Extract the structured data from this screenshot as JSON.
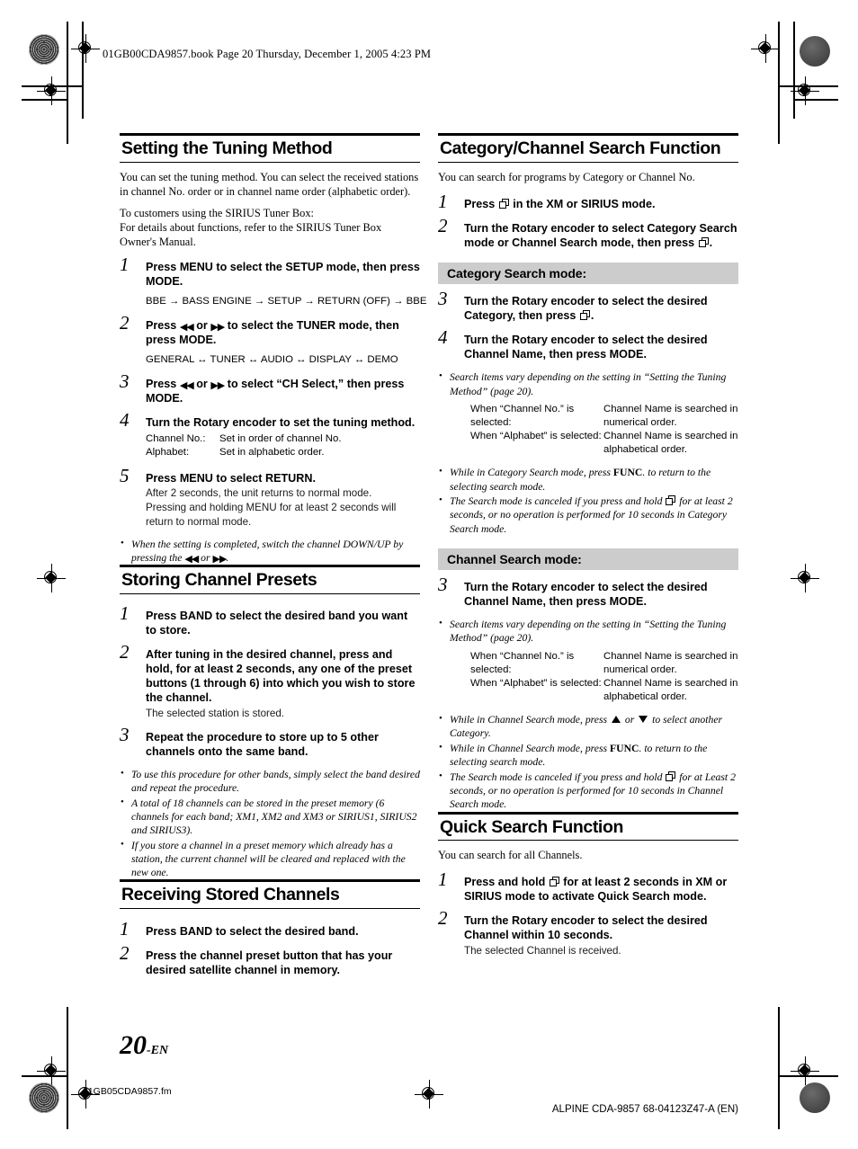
{
  "page": {
    "header_note": "01GB00CDA9857.book  Page 20  Thursday, December 1, 2005  4:23 PM",
    "page_number": "20",
    "page_number_suffix": "-EN",
    "footer_left": "01GB05CDA9857.fm",
    "footer_right": "ALPINE CDA-9857 68-04123Z47-A (EN)"
  },
  "left": {
    "s1": {
      "title": "Setting the Tuning Method",
      "intro1": "You can set the tuning method. You can select the received stations in channel No. order or in channel name order (alphabetic order).",
      "intro2_line1": "To customers using the SIRIUS Tuner Box:",
      "intro2_line2": "For details about functions, refer to the SIRIUS Tuner Box Owner's Manual.",
      "step1_num": "1",
      "step1_a": "Press ",
      "step1_b": "MENU",
      "step1_c": " to select the SETUP mode, then press ",
      "step1_d": "MODE",
      "step1_e": ".",
      "flow1": "BBE → BASS ENGINE → SETUP → RETURN (OFF) → BBE",
      "step2_num": "2",
      "step2_a": "Press ",
      "step2_b": " or ",
      "step2_c": " to select the TUNER mode, then press ",
      "step2_d": "MODE",
      "step2_e": ".",
      "flow2": "GENERAL ↔ TUNER ↔ AUDIO ↔ DISPLAY ↔ DEMO",
      "step3_num": "3",
      "step3_a": "Press ",
      "step3_b": " or ",
      "step3_c": " to select “CH Select,” then press ",
      "step3_d": "MODE",
      "step3_e": ".",
      "step4_num": "4",
      "step4_a": "Turn the ",
      "step4_b": "Rotary encoder",
      "step4_c": " to set the tuning method.",
      "kv": [
        {
          "k": "Channel No.:",
          "v": "Set in order of channel No."
        },
        {
          "k": "Alphabet:",
          "v": "Set in alphabetic order."
        }
      ],
      "step5_num": "5",
      "step5_a": "Press ",
      "step5_b": "MENU",
      "step5_c": " to select RETURN.",
      "step5_sub1": "After 2 seconds, the unit returns to normal mode.",
      "step5_sub2": "Pressing and holding MENU for at least 2 seconds will return to normal mode.",
      "note1_a": "When the setting is completed, switch the channel DOWN/UP by pressing the ",
      "note1_b": " or ",
      "note1_c": "."
    },
    "s2": {
      "title": "Storing Channel Presets",
      "step1_num": "1",
      "step1_a": "Press ",
      "step1_b": "BAND",
      "step1_c": " to select the desired band you want to store.",
      "step2_num": "2",
      "step2_a": "After tuning in the desired channel, press and hold, for at least 2 seconds, any one of the ",
      "step2_b": "preset buttons (1 through 6)",
      "step2_c": " into which you wish to store the channel.",
      "step2_sub": "The selected station is stored.",
      "step3_num": "3",
      "step3_a": "Repeat the procedure to store up to 5 other channels onto the same band.",
      "notes": [
        "To use this procedure for other bands, simply select the band desired and repeat the procedure.",
        "A total of 18 channels can be stored in the preset memory (6 channels for each band; XM1, XM2 and XM3 or SIRIUS1, SIRIUS2 and SIRIUS3).",
        "If you store a channel in a preset memory which already has a station, the current channel will be cleared and replaced with the new one."
      ]
    },
    "s3": {
      "title": "Receiving Stored Channels",
      "step1_num": "1",
      "step1_a": "Press ",
      "step1_b": "BAND",
      "step1_c": " to select the desired band.",
      "step2_num": "2",
      "step2_a": "Press the channel ",
      "step2_b": "preset button",
      "step2_c": " that has your desired satellite channel in memory."
    }
  },
  "right": {
    "s1": {
      "title": "Category/Channel Search Function",
      "intro": "You can search for programs by Category or Channel No.",
      "step1_num": "1",
      "step1_a": "Press ",
      "step1_b": " in the XM or SIRIUS mode.",
      "step2_num": "2",
      "step2_a": "Turn the ",
      "step2_b": "Rotary encoder",
      "step2_c": " to select Category Search mode or Channel Search mode, then press ",
      "step2_d": ".",
      "cat_bar": "Category Search mode:",
      "cat_step3_num": "3",
      "cat_step3_a": "Turn the ",
      "cat_step3_b": "Rotary encoder",
      "cat_step3_c": " to select the desired Category, then press ",
      "cat_step3_d": ".",
      "cat_step4_num": "4",
      "cat_step4_a": "Turn the ",
      "cat_step4_b": "Rotary encoder",
      "cat_step4_c": " to select the desired Channel Name, then press ",
      "cat_step4_d": "MODE",
      "cat_step4_e": ".",
      "cat_note1": "Search items vary depending on the setting in “Setting the Tuning Method” (page 20).",
      "cat_kv": [
        {
          "k": "When “Channel No.” is selected:",
          "v": "Channel Name is searched in numerical order."
        },
        {
          "k": "When “Alphabet” is selected:",
          "v": "Channel Name is searched in alphabetical order."
        }
      ],
      "cat_note2_a": "While in Category Search mode, press ",
      "cat_note2_b": "FUNC",
      "cat_note2_c": ". to return to the selecting search mode.",
      "cat_note3_a": "The Search mode is canceled if you press and hold ",
      "cat_note3_b": " for at least 2 seconds, or no operation is performed for 10 seconds in Category Search mode.",
      "chan_bar": "Channel Search mode:",
      "chan_step3_num": "3",
      "chan_step3_a": "Turn the ",
      "chan_step3_b": "Rotary encoder",
      "chan_step3_c": " to select the desired Channel Name, then press ",
      "chan_step3_d": "MODE",
      "chan_step3_e": ".",
      "chan_note1": "Search items vary depending on the setting in “Setting the Tuning Method” (page 20).",
      "chan_kv": [
        {
          "k": "When “Channel No.” is selected:",
          "v": "Channel Name is searched in numerical order."
        },
        {
          "k": "When “Alphabet” is selected:",
          "v": "Channel Name is searched in alphabetical order."
        }
      ],
      "chan_note2_a": "While in Channel Search mode, press ",
      "chan_note2_b": " or ",
      "chan_note2_c": " to select another Category.",
      "chan_note3_a": "While in Channel Search mode, press ",
      "chan_note3_b": "FUNC",
      "chan_note3_c": ". to return to the selecting search mode.",
      "chan_note4_a": "The Search mode is canceled if you press and hold ",
      "chan_note4_b": " for at Least 2 seconds, or no operation is performed for 10 seconds in Channel Search mode."
    },
    "s2": {
      "title": "Quick Search Function",
      "intro": "You can search for all Channels.",
      "step1_num": "1",
      "step1_a": "Press and hold ",
      "step1_b": " for at least 2 seconds in XM or SIRIUS mode to activate Quick Search mode.",
      "step2_num": "2",
      "step2_a": "Turn the ",
      "step2_b": "Rotary encoder",
      "step2_c": " to select the desired Channel within 10 seconds.",
      "step2_sub": "The selected Channel is received."
    }
  },
  "glyphs": {
    "prev": "◀◀",
    "next": "▶▶",
    "arrow_right": "→",
    "arrow_both": "↔"
  }
}
